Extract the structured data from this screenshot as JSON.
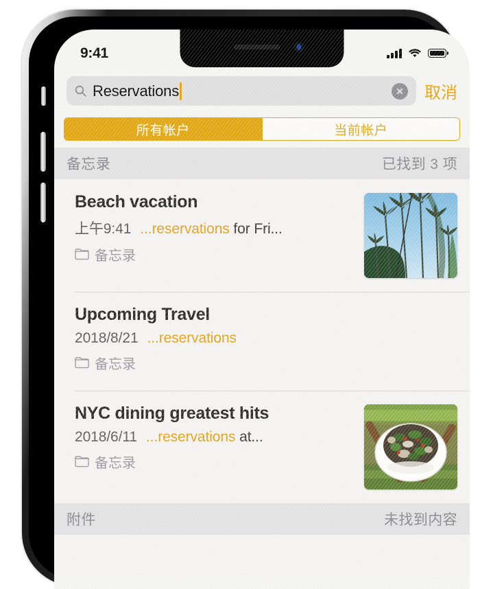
{
  "device": {
    "buttons": [
      "silent-switch",
      "volume-up",
      "volume-down",
      "side-button"
    ]
  },
  "status_bar": {
    "time": "9:41",
    "cellular_icon": "signal-bars-icon",
    "wifi_icon": "wifi-icon",
    "battery_icon": "battery-icon"
  },
  "search": {
    "icon": "search-icon",
    "value": "Reservations",
    "clear_icon": "clear-circle-icon",
    "cancel_label": "取消",
    "accent_color": "#e6a316"
  },
  "segmented_control": {
    "segments": [
      {
        "label": "所有帐户",
        "selected": true
      },
      {
        "label": "当前帐户",
        "selected": false
      }
    ],
    "accent_color": "#e3a714"
  },
  "sections": [
    {
      "title": "备忘录",
      "status": "已找到 3 项"
    },
    {
      "title": "附件",
      "status": "未找到内容"
    }
  ],
  "notes": [
    {
      "title": "Beach vacation",
      "date": "上午9:41",
      "snippet_prefix": "...",
      "snippet_highlight": "reservations",
      "snippet_suffix": " for Fri...",
      "folder_icon": "folder-icon",
      "folder_label": "备忘录",
      "thumbnail": "palm-trees-photo"
    },
    {
      "title": "Upcoming Travel",
      "date": "2018/8/21",
      "snippet_prefix": "...",
      "snippet_highlight": "reservations",
      "snippet_suffix": "",
      "folder_icon": "folder-icon",
      "folder_label": "备忘录",
      "thumbnail": ""
    },
    {
      "title": "NYC dining greatest hits",
      "date": "2018/6/11",
      "snippet_prefix": "...",
      "snippet_highlight": "reservations",
      "snippet_suffix": " at...",
      "folder_icon": "folder-icon",
      "folder_label": "备忘录",
      "thumbnail": "salad-bowl-photo"
    }
  ],
  "colors": {
    "highlight": "#e4a21a",
    "title": "#2c2c2c",
    "secondary": "#8a8a8e",
    "section_bg": "#e2e2e2",
    "list_bg": "#f4f3f1"
  }
}
